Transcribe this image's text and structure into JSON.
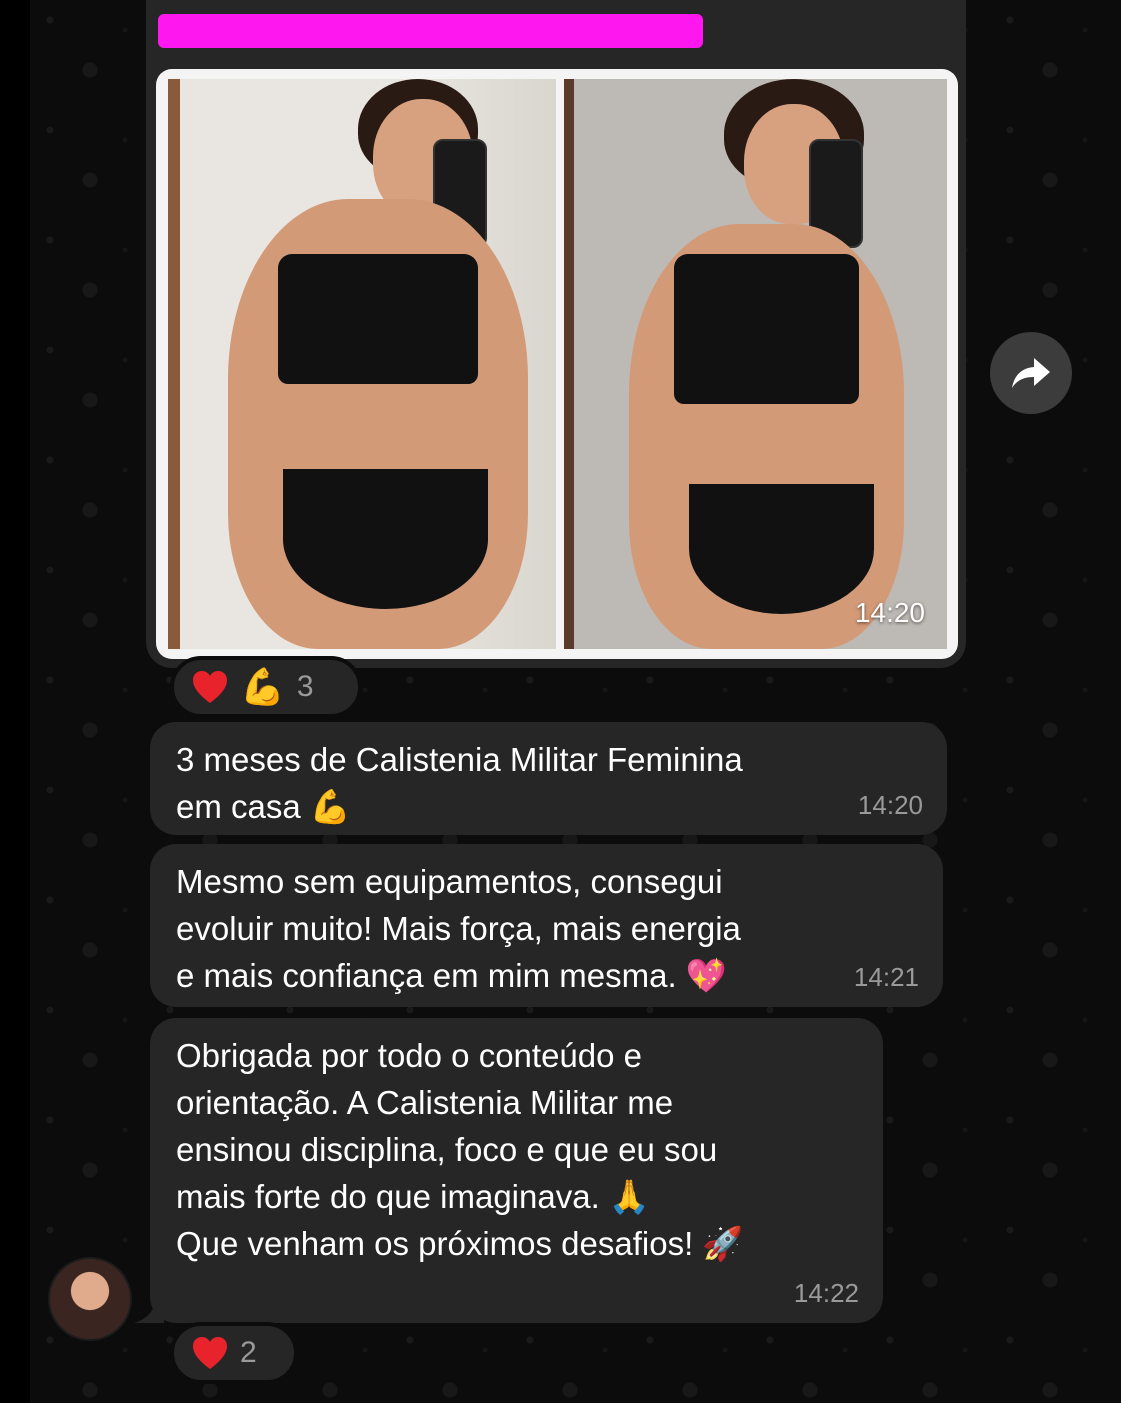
{
  "chat": {
    "photo_message": {
      "time": "14:20",
      "reactions": {
        "emoji": "💪",
        "count": "3"
      }
    },
    "messages": [
      {
        "text": "3 meses de Calistenia Militar Feminina\nem casa 💪",
        "time": "14:20"
      },
      {
        "text": "Mesmo sem equipamentos, consegui\nevoluir muito! Mais força, mais energia\ne mais confiança em mim mesma. 💖",
        "time": "14:21"
      },
      {
        "text": "Obrigada por todo o conteúdo e\norientação. A Calistenia Militar me\nensinou disciplina, foco e que eu sou\nmais forte do que imaginava. 🙏\nQue venham os próximos desafios! 🚀",
        "time": "14:22"
      }
    ],
    "last_reactions": {
      "count": "2"
    }
  },
  "icons": {
    "forward": "forward-arrow-icon",
    "heart": "heart-icon"
  },
  "colors": {
    "bubble": "#262626",
    "background": "#0c0c0c",
    "redaction": "#ff17f0",
    "heart": "#e8232c",
    "muted_text": "#9a9a9a"
  }
}
